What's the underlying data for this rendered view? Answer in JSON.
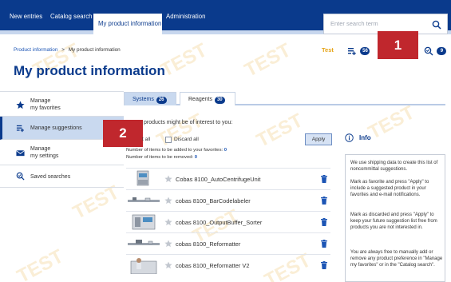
{
  "topnav": {
    "items": [
      "New entries",
      "Catalog search",
      "My product information",
      "Administration"
    ],
    "search_placeholder": "Enter search term"
  },
  "breadcrumb": {
    "root": "Product information",
    "sep": ">",
    "current": "My product information"
  },
  "header_badges": {
    "test_label": "Test",
    "suggestions_count": "56",
    "searches_count": "9"
  },
  "callouts": {
    "one": "1",
    "two": "2"
  },
  "page_title": "My product information",
  "sidebar": {
    "items": [
      {
        "label_line1": "Manage",
        "label_line2": "my favorites",
        "icon": "star-icon"
      },
      {
        "label_line1": "Manage suggestions",
        "label_line2": "",
        "icon": "suggestions-icon"
      },
      {
        "label_line1": "Manage",
        "label_line2": "my settings",
        "icon": "envelope-icon"
      },
      {
        "label_line1": "Saved searches",
        "label_line2": "",
        "icon": "saved-search-icon"
      }
    ]
  },
  "tabs": [
    {
      "label": "Systems",
      "count": "26"
    },
    {
      "label": "Reagents",
      "count": "30"
    }
  ],
  "main": {
    "intro": "products might be of interest to you:",
    "select_all_label": "t all",
    "discard_all_label": "Discard all",
    "added_label": "Number of items to be added to your favorites:",
    "added_count": "0",
    "removed_label": "Number of items to be removed:",
    "removed_count": "0",
    "apply_label": "Apply"
  },
  "products": [
    "Cobas 8100_AutoCentrifugeUnit",
    "cobas 8100_BarCodelabeler",
    "cobas 8100_OutputBuffer_Sorter",
    "cobas 8100_Reformatter",
    "cobas 8100_Reformatter V2"
  ],
  "info": {
    "title": "Info",
    "p1": "We use shipping data to create this list of noncommittal suggestions.",
    "p2": "Mark as favorite and press \"Apply\" to include a suggested product in your favorites and e-mail notifications.",
    "p3": "Mark as discarded and press \"Apply\" to keep your future suggestion list free from products you are not interested in.",
    "p4": "You are always free to manually add or remove any product preference in \"Manage my favorites\" or in the \"Catalog search\"."
  },
  "watermark": "TEST",
  "colors": {
    "brand": "#0a3a8c",
    "callout": "#c0272d",
    "active_bg": "#c9d9ef",
    "test_tag": "#e6a417"
  }
}
